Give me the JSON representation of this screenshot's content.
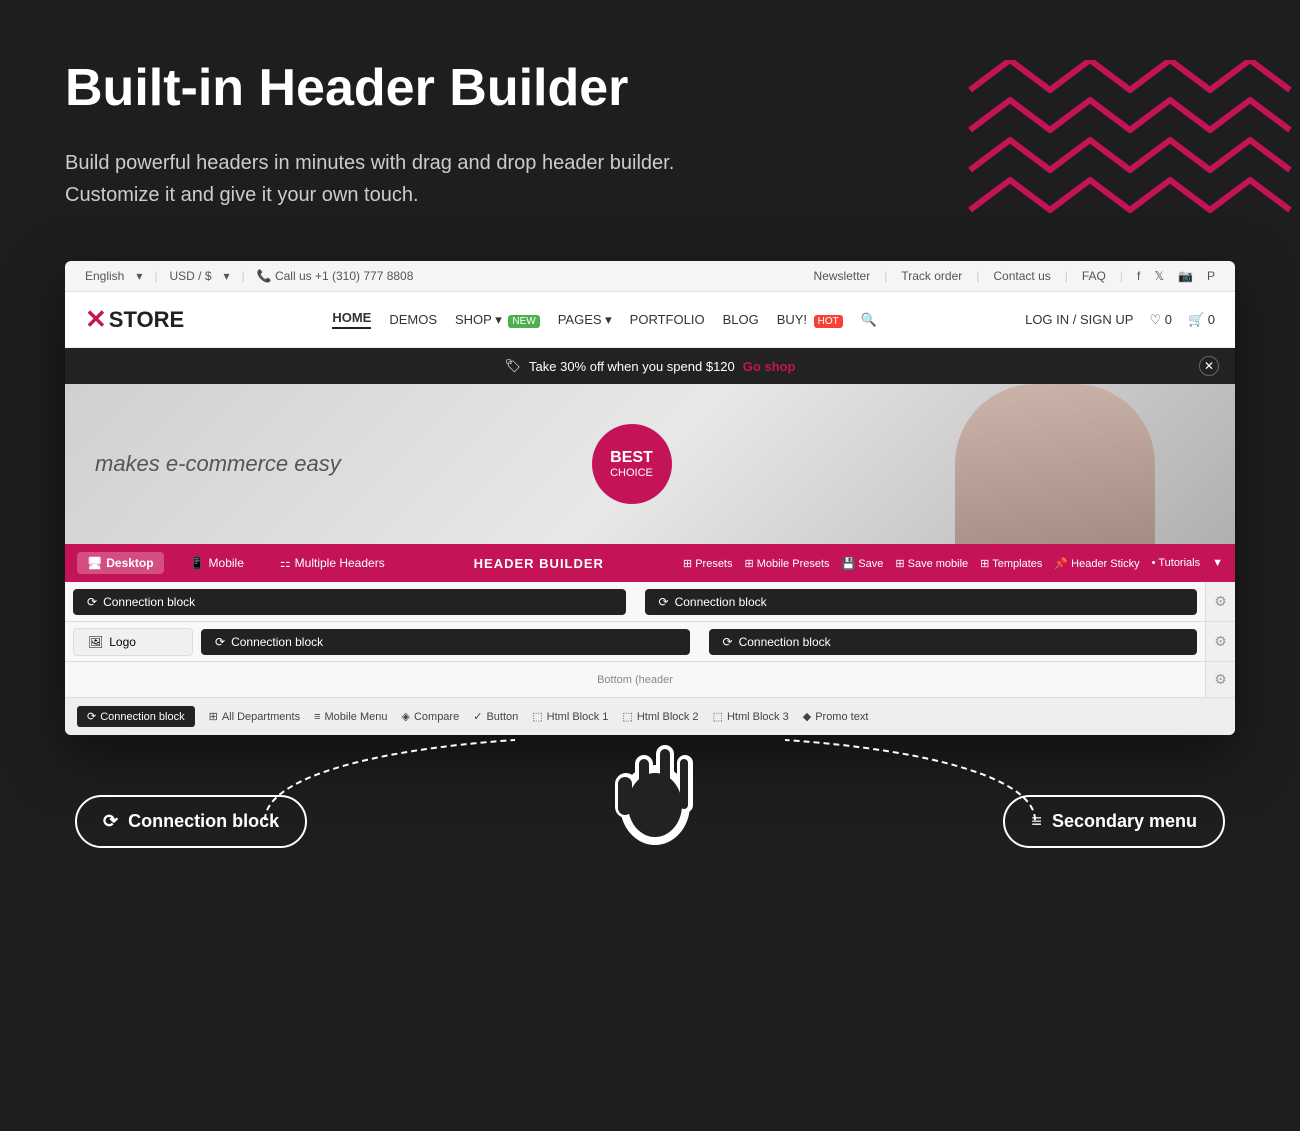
{
  "page": {
    "title": "Built-in Header Builder",
    "subtitle_line1": "Build powerful headers in minutes with drag and drop header builder.",
    "subtitle_line2": "Customize it and give it your own touch."
  },
  "topbar": {
    "language": "English",
    "currency": "USD / $",
    "phone": "Call us +1 (310) 777 8808",
    "newsletter": "Newsletter",
    "track_order": "Track order",
    "contact": "Contact us",
    "faq": "FAQ"
  },
  "navbar": {
    "logo_prefix": "X",
    "logo_text": "STORE",
    "nav_items": [
      "HOME",
      "DEMOS",
      "SHOP",
      "PAGES",
      "PORTFOLIO",
      "BLOG",
      "BUY!"
    ],
    "login": "LOG IN / SIGN UP"
  },
  "promo": {
    "text": "Take 30% off when you spend $120",
    "link": "Go shop"
  },
  "hero": {
    "tagline": "makes e-commerce easy",
    "badge_line1": "BEST",
    "badge_line2": "CHOICE"
  },
  "header_builder": {
    "tabs": [
      "Desktop",
      "Mobile",
      "Multiple Headers"
    ],
    "title": "HEADER BUILDER",
    "actions": [
      "Presets",
      "Mobile Presets",
      "Save",
      "Save mobile",
      "Templates",
      "Header Sticky",
      "Tutorials"
    ]
  },
  "builder_rows": {
    "row1_left": "Connection block",
    "row1_right": "Connection block",
    "row2_logo": "Logo",
    "row2_mid": "Connection block",
    "row2_right": "Connection block",
    "row3_label": "Bottom (header",
    "tools": [
      "Connection block",
      "All Departments",
      "Mobile Menu",
      "Compare",
      "Button",
      "Html Block 1",
      "Html Block 2",
      "Html Block 3",
      "Promo text"
    ]
  },
  "callouts": {
    "connection_block": "Connection block",
    "secondary_menu": "Secondary menu"
  },
  "icons": {
    "connection": "⟳",
    "logo": "🖼",
    "menu": "≡",
    "settings": "⚙"
  }
}
